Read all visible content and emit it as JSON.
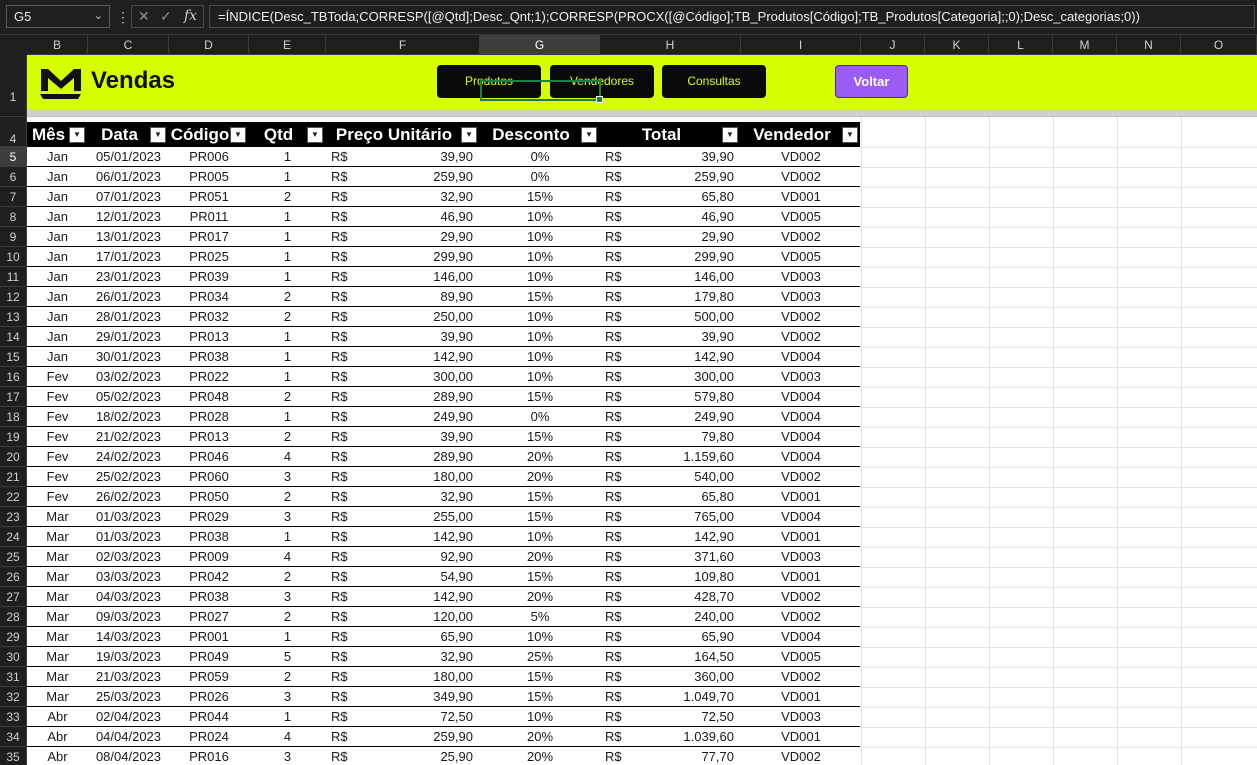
{
  "formula_bar": {
    "name_box": "G5",
    "formula": "=ÍNDICE(Desc_TBToda;CORRESP([@Qtd];Desc_Qnt;1);CORRESP(PROCX([@Código];TB_Produtos[Código];TB_Produtos[Categoria];;0);Desc_categorias;0))",
    "cancel_icon": "close-icon",
    "enter_icon": "check-icon",
    "fx_label": "fx"
  },
  "columns": [
    "B",
    "C",
    "D",
    "E",
    "F",
    "G",
    "H",
    "I",
    "J",
    "K",
    "L",
    "M",
    "N",
    "O"
  ],
  "selected_column": "G",
  "row_numbers": [
    "1",
    "4",
    "5",
    "6",
    "7",
    "8",
    "9",
    "10",
    "11",
    "12",
    "13",
    "14",
    "15",
    "16",
    "17",
    "18",
    "19",
    "20",
    "21",
    "22",
    "23",
    "24",
    "25",
    "26",
    "27",
    "28",
    "29",
    "30",
    "31",
    "32",
    "33",
    "34",
    "35"
  ],
  "selected_row": "5",
  "banner": {
    "title": "Vendas",
    "logo_icon": "m-logo-icon",
    "accent_color": "#d8ff00",
    "buttons": [
      {
        "label": "Produtos"
      },
      {
        "label": "Vendedores"
      },
      {
        "label": "Consultas"
      }
    ],
    "back_button": {
      "label": "Voltar",
      "color": "#9b5cf6"
    }
  },
  "table": {
    "headers": [
      "Mês",
      "Data",
      "Código",
      "Qtd",
      "Preço Unitário",
      "Desconto",
      "Total",
      "Vendedor"
    ],
    "currency": "R$",
    "rows": [
      [
        "Jan",
        "05/01/2023",
        "PR006",
        "1",
        "39,90",
        "0%",
        "39,90",
        "VD002"
      ],
      [
        "Jan",
        "06/01/2023",
        "PR005",
        "1",
        "259,90",
        "0%",
        "259,90",
        "VD002"
      ],
      [
        "Jan",
        "07/01/2023",
        "PR051",
        "2",
        "32,90",
        "15%",
        "65,80",
        "VD001"
      ],
      [
        "Jan",
        "12/01/2023",
        "PR011",
        "1",
        "46,90",
        "10%",
        "46,90",
        "VD005"
      ],
      [
        "Jan",
        "13/01/2023",
        "PR017",
        "1",
        "29,90",
        "10%",
        "29,90",
        "VD002"
      ],
      [
        "Jan",
        "17/01/2023",
        "PR025",
        "1",
        "299,90",
        "10%",
        "299,90",
        "VD005"
      ],
      [
        "Jan",
        "23/01/2023",
        "PR039",
        "1",
        "146,00",
        "10%",
        "146,00",
        "VD003"
      ],
      [
        "Jan",
        "26/01/2023",
        "PR034",
        "2",
        "89,90",
        "15%",
        "179,80",
        "VD003"
      ],
      [
        "Jan",
        "28/01/2023",
        "PR032",
        "2",
        "250,00",
        "10%",
        "500,00",
        "VD002"
      ],
      [
        "Jan",
        "29/01/2023",
        "PR013",
        "1",
        "39,90",
        "10%",
        "39,90",
        "VD002"
      ],
      [
        "Jan",
        "30/01/2023",
        "PR038",
        "1",
        "142,90",
        "10%",
        "142,90",
        "VD004"
      ],
      [
        "Fev",
        "03/02/2023",
        "PR022",
        "1",
        "300,00",
        "10%",
        "300,00",
        "VD003"
      ],
      [
        "Fev",
        "05/02/2023",
        "PR048",
        "2",
        "289,90",
        "15%",
        "579,80",
        "VD004"
      ],
      [
        "Fev",
        "18/02/2023",
        "PR028",
        "1",
        "249,90",
        "0%",
        "249,90",
        "VD004"
      ],
      [
        "Fev",
        "21/02/2023",
        "PR013",
        "2",
        "39,90",
        "15%",
        "79,80",
        "VD004"
      ],
      [
        "Fev",
        "24/02/2023",
        "PR046",
        "4",
        "289,90",
        "20%",
        "1.159,60",
        "VD004"
      ],
      [
        "Fev",
        "25/02/2023",
        "PR060",
        "3",
        "180,00",
        "20%",
        "540,00",
        "VD002"
      ],
      [
        "Fev",
        "26/02/2023",
        "PR050",
        "2",
        "32,90",
        "15%",
        "65,80",
        "VD001"
      ],
      [
        "Mar",
        "01/03/2023",
        "PR029",
        "3",
        "255,00",
        "15%",
        "765,00",
        "VD004"
      ],
      [
        "Mar",
        "01/03/2023",
        "PR038",
        "1",
        "142,90",
        "10%",
        "142,90",
        "VD001"
      ],
      [
        "Mar",
        "02/03/2023",
        "PR009",
        "4",
        "92,90",
        "20%",
        "371,60",
        "VD003"
      ],
      [
        "Mar",
        "03/03/2023",
        "PR042",
        "2",
        "54,90",
        "15%",
        "109,80",
        "VD001"
      ],
      [
        "Mar",
        "04/03/2023",
        "PR038",
        "3",
        "142,90",
        "20%",
        "428,70",
        "VD002"
      ],
      [
        "Mar",
        "09/03/2023",
        "PR027",
        "2",
        "120,00",
        "5%",
        "240,00",
        "VD002"
      ],
      [
        "Mar",
        "14/03/2023",
        "PR001",
        "1",
        "65,90",
        "10%",
        "65,90",
        "VD004"
      ],
      [
        "Mar",
        "19/03/2023",
        "PR049",
        "5",
        "32,90",
        "25%",
        "164,50",
        "VD005"
      ],
      [
        "Mar",
        "21/03/2023",
        "PR059",
        "2",
        "180,00",
        "15%",
        "360,00",
        "VD002"
      ],
      [
        "Mar",
        "25/03/2023",
        "PR026",
        "3",
        "349,90",
        "15%",
        "1.049,70",
        "VD001"
      ],
      [
        "Abr",
        "02/04/2023",
        "PR044",
        "1",
        "72,50",
        "10%",
        "72,50",
        "VD003"
      ],
      [
        "Abr",
        "04/04/2023",
        "PR024",
        "4",
        "259,90",
        "20%",
        "1.039,60",
        "VD001"
      ],
      [
        "Abr",
        "08/04/2023",
        "PR016",
        "3",
        "25,90",
        "20%",
        "77,70",
        "VD002"
      ]
    ]
  }
}
